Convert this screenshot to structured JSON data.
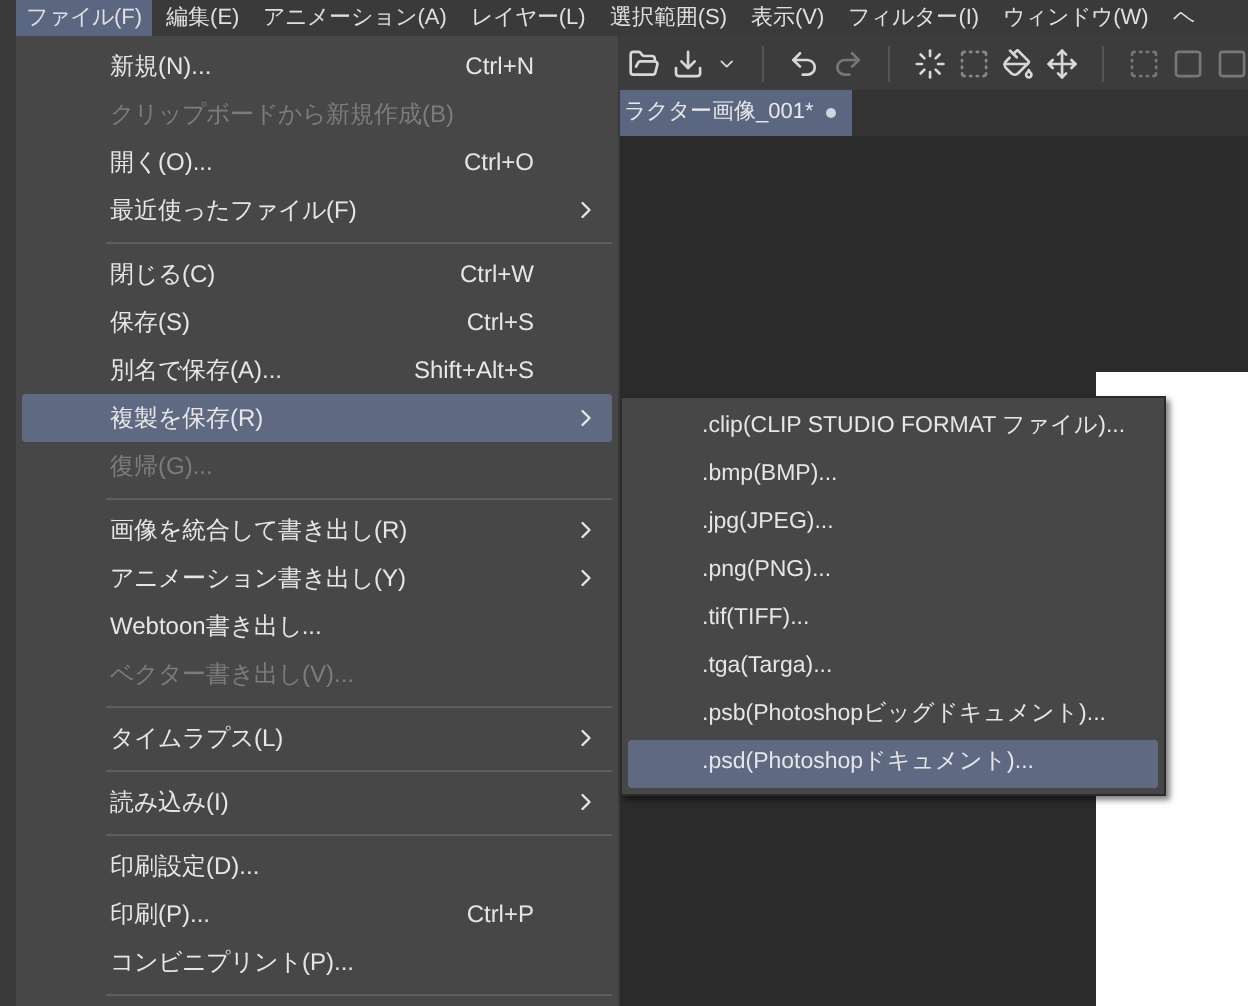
{
  "menu_bar": [
    {
      "label": "ファイル(F)",
      "selected": true
    },
    {
      "label": "編集(E)",
      "selected": false
    },
    {
      "label": "アニメーション(A)",
      "selected": false
    },
    {
      "label": "レイヤー(L)",
      "selected": false
    },
    {
      "label": "選択範囲(S)",
      "selected": false
    },
    {
      "label": "表示(V)",
      "selected": false
    },
    {
      "label": "フィルター(I)",
      "selected": false
    },
    {
      "label": "ウィンドウ(W)",
      "selected": false
    },
    {
      "label": "ヘ",
      "selected": false
    }
  ],
  "document_tab": {
    "title": "ラクター画像_001*"
  },
  "file_menu": {
    "items": [
      {
        "kind": "item",
        "label": "新規(N)...",
        "shortcut": "Ctrl+N",
        "disabled": false,
        "submenu": false,
        "selected": false
      },
      {
        "kind": "item",
        "label": "クリップボードから新規作成(B)",
        "disabled": true,
        "submenu": false,
        "selected": false
      },
      {
        "kind": "item",
        "label": "開く(O)...",
        "shortcut": "Ctrl+O",
        "disabled": false,
        "submenu": false,
        "selected": false
      },
      {
        "kind": "item",
        "label": "最近使ったファイル(F)",
        "disabled": false,
        "submenu": true,
        "selected": false
      },
      {
        "kind": "separator"
      },
      {
        "kind": "item",
        "label": "閉じる(C)",
        "shortcut": "Ctrl+W",
        "disabled": false,
        "submenu": false,
        "selected": false
      },
      {
        "kind": "item",
        "label": "保存(S)",
        "shortcut": "Ctrl+S",
        "disabled": false,
        "submenu": false,
        "selected": false
      },
      {
        "kind": "item",
        "label": "別名で保存(A)...",
        "shortcut": "Shift+Alt+S",
        "disabled": false,
        "submenu": false,
        "selected": false
      },
      {
        "kind": "item",
        "label": "複製を保存(R)",
        "disabled": false,
        "submenu": true,
        "selected": true
      },
      {
        "kind": "item",
        "label": "復帰(G)...",
        "disabled": true,
        "submenu": false,
        "selected": false
      },
      {
        "kind": "separator"
      },
      {
        "kind": "item",
        "label": "画像を統合して書き出し(R)",
        "disabled": false,
        "submenu": true,
        "selected": false
      },
      {
        "kind": "item",
        "label": "アニメーション書き出し(Y)",
        "disabled": false,
        "submenu": true,
        "selected": false
      },
      {
        "kind": "item",
        "label": "Webtoon書き出し...",
        "disabled": false,
        "submenu": false,
        "selected": false
      },
      {
        "kind": "item",
        "label": "ベクター書き出し(V)...",
        "disabled": true,
        "submenu": false,
        "selected": false
      },
      {
        "kind": "separator"
      },
      {
        "kind": "item",
        "label": "タイムラプス(L)",
        "disabled": false,
        "submenu": true,
        "selected": false
      },
      {
        "kind": "separator"
      },
      {
        "kind": "item",
        "label": "読み込み(I)",
        "disabled": false,
        "submenu": true,
        "selected": false
      },
      {
        "kind": "separator"
      },
      {
        "kind": "item",
        "label": "印刷設定(D)...",
        "disabled": false,
        "submenu": false,
        "selected": false
      },
      {
        "kind": "item",
        "label": "印刷(P)...",
        "shortcut": "Ctrl+P",
        "disabled": false,
        "submenu": false,
        "selected": false
      },
      {
        "kind": "item",
        "label": "コンビニプリント(P)...",
        "disabled": false,
        "submenu": false,
        "selected": false
      },
      {
        "kind": "separator"
      }
    ]
  },
  "save_copy_submenu": {
    "items": [
      {
        "label": ".clip(CLIP STUDIO FORMAT ファイル)...",
        "selected": false
      },
      {
        "label": ".bmp(BMP)...",
        "selected": false
      },
      {
        "label": ".jpg(JPEG)...",
        "selected": false
      },
      {
        "label": ".png(PNG)...",
        "selected": false
      },
      {
        "label": ".tif(TIFF)...",
        "selected": false
      },
      {
        "label": ".tga(Targa)...",
        "selected": false
      },
      {
        "label": ".psb(Photoshopビッグドキュメント)...",
        "selected": false
      },
      {
        "label": ".psd(Photoshopドキュメント)...",
        "selected": true
      }
    ]
  }
}
